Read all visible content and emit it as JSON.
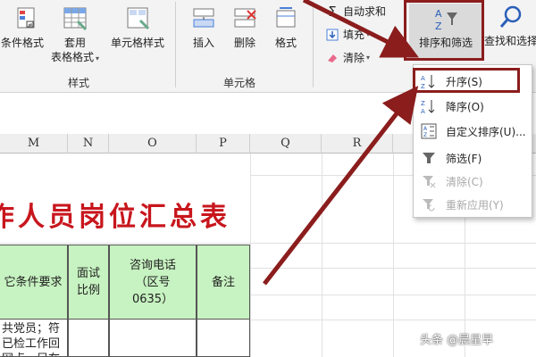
{
  "ribbon": {
    "styles_group": {
      "label": "样式",
      "conditional_format": "条件格式",
      "format_as_table_line1": "套用",
      "format_as_table_line2": "表格格式",
      "cell_styles": "单元格样式"
    },
    "cells_group": {
      "label": "单元格",
      "insert": "插入",
      "delete": "删除",
      "format": "格式"
    },
    "editing_group": {
      "autosum": "自动求和",
      "fill": "填充",
      "clear": "清除",
      "sort_filter": "排序和筛选",
      "find_select": "查找和选择"
    }
  },
  "sort_menu": {
    "items": [
      {
        "label": "升序(S)",
        "icon": "sort-ascending-icon",
        "enabled": true
      },
      {
        "label": "降序(O)",
        "icon": "sort-descending-icon",
        "enabled": true
      },
      {
        "label": "自定义排序(U)...",
        "icon": "custom-sort-icon",
        "enabled": true
      },
      {
        "label": "筛选(F)",
        "icon": "filter-icon",
        "enabled": true
      },
      {
        "label": "清除(C)",
        "icon": "clear-filter-icon",
        "enabled": false
      },
      {
        "label": "重新应用(Y)",
        "icon": "reapply-icon",
        "enabled": false
      }
    ]
  },
  "sheet": {
    "columns": [
      "M",
      "N",
      "O",
      "P",
      "Q",
      "R"
    ],
    "title": "作人员岗位汇总表",
    "table_headers": [
      "它条件要求",
      "面试\n比例",
      "咨询电话\n（区号\n0635）",
      "备注"
    ],
    "first_row_cell": "共党员；符\n已检工作回\n网点，另在"
  },
  "watermark": "头条 @晨星早",
  "colors": {
    "title_red": "#c8161d",
    "header_green": "#c7f2c1",
    "arrow_dark_red": "#8b1d1d"
  }
}
